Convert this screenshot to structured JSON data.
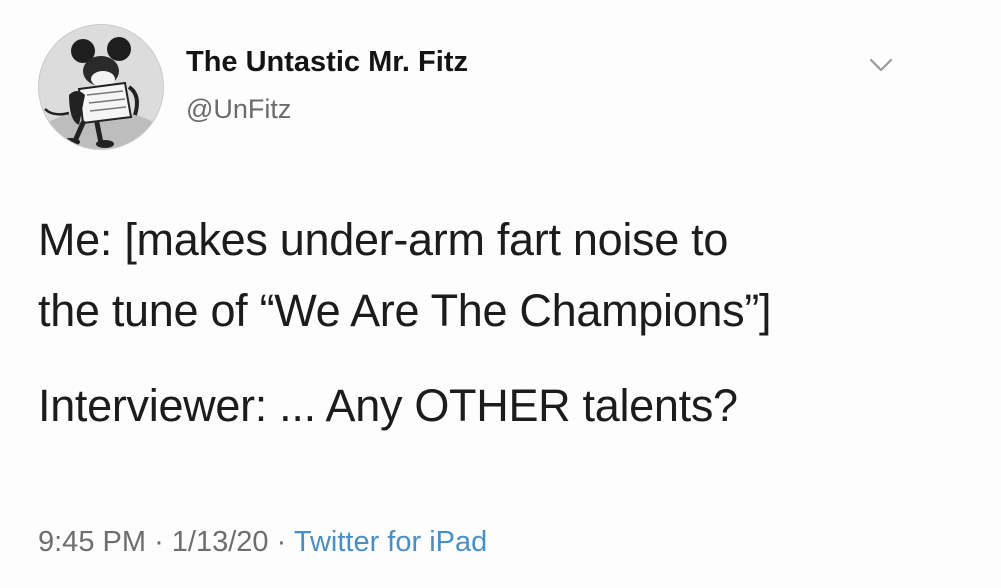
{
  "author": {
    "display_name": "The Untastic Mr. Fitz",
    "handle": "@UnFitz",
    "avatar_icon": "cartoon-mouse-avatar"
  },
  "tweet": {
    "lines": [
      "Me: [makes under-arm fart noise to",
      "the tune of “We Are The Champions”]",
      "Interviewer: ... Any OTHER talents?"
    ]
  },
  "meta": {
    "time": "9:45 PM",
    "separator": "·",
    "date": "1/13/20",
    "source": "Twitter for iPad"
  },
  "colors": {
    "link": "#4a8fc4",
    "muted": "#6e6e6e",
    "text": "#1c1c1c"
  }
}
